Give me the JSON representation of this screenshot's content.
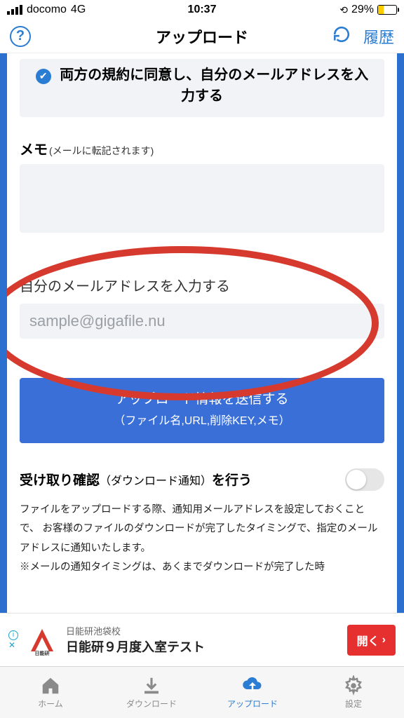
{
  "status": {
    "carrier": "docomo",
    "network": "4G",
    "time": "10:37",
    "battery_pct": "29%"
  },
  "nav": {
    "title": "アップロード",
    "history": "履歴"
  },
  "agree": {
    "text": "両方の規約に同意し、自分のメールアドレスを入力する"
  },
  "memo": {
    "label": "メモ",
    "sub": "(メールに転記されます)"
  },
  "email": {
    "label": "自分のメールアドレスを入力する",
    "placeholder": "sample@gigafile.nu"
  },
  "submit": {
    "main": "アップロード情報を送信する",
    "sub": "（ファイル名,URL,削除KEY,メモ）"
  },
  "notify": {
    "label_a": "受け取り確認",
    "label_b": "（ダウンロード通知）",
    "label_c": "を行う",
    "desc": "ファイルをアップロードする際、通知用メールアドレスを設定しておくことで、 お客様のファイルのダウンロードが完了したタイミングで、指定のメールアドレスに通知いたします。\n※メールの通知タイミングは、あくまでダウンロードが完了した時"
  },
  "ad": {
    "subtitle": "日能研池袋校",
    "title": "日能研９月度入室テスト",
    "cta": "開く",
    "logo_text": "日能研"
  },
  "tabs": {
    "home": "ホーム",
    "download": "ダウンロード",
    "upload": "アップロード",
    "settings": "設定"
  }
}
